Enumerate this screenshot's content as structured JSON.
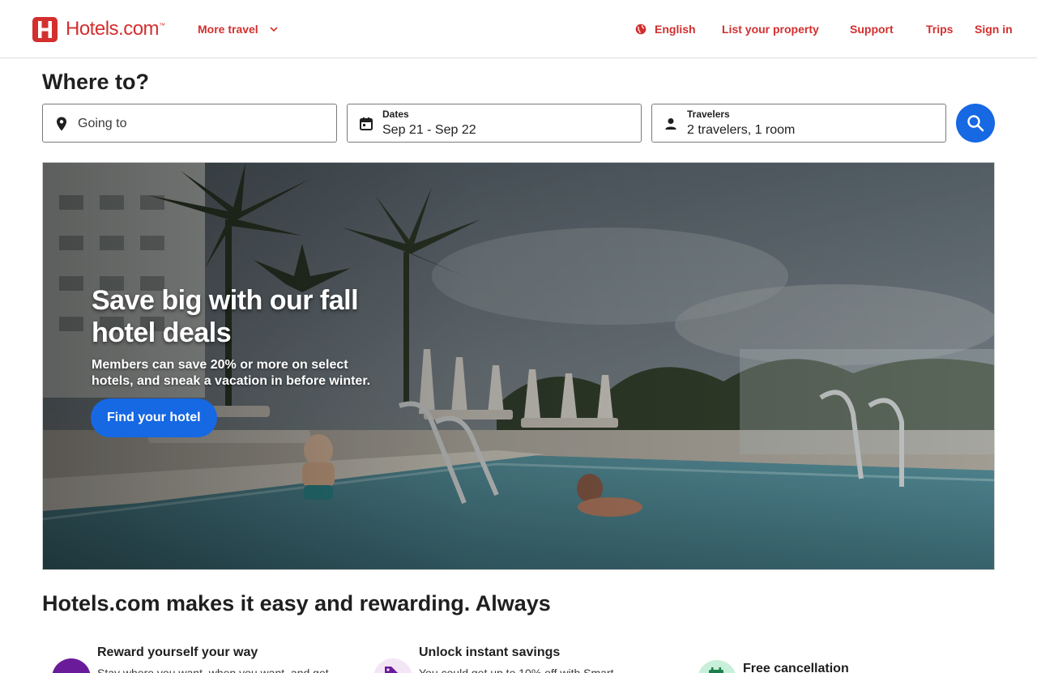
{
  "header": {
    "logo_text": "Hotels.com",
    "logo_tm": "™",
    "more_travel": "More travel",
    "language": "English",
    "list_property": "List your property",
    "support": "Support",
    "trips": "Trips",
    "sign_in": "Sign in",
    "brand_color": "#d32f2f"
  },
  "search": {
    "heading": "Where to?",
    "destination_placeholder": "Going to",
    "dates_label": "Dates",
    "dates_value": "Sep 21 - Sep 22",
    "travelers_label": "Travelers",
    "travelers_value": "2 travelers, 1 room",
    "button_color": "#1668e3"
  },
  "hero": {
    "title": "Save big with our fall hotel deals",
    "subtitle": "Members can save 20% or more on select hotels, and sneak a vacation in before winter.",
    "cta": "Find your hotel"
  },
  "section": {
    "title": "Hotels.com makes it easy and rewarding. Always",
    "features": [
      {
        "title": "Reward yourself your way",
        "desc": "Stay where you want, when you want, and get",
        "icon": "reward-icon",
        "color": "#6a1b9a"
      },
      {
        "title": "Unlock instant savings",
        "desc": "You could get up to 10% off with Smart",
        "icon": "tag-icon",
        "color": "#f3e5f5"
      },
      {
        "title": "Free cancellation",
        "desc": "",
        "icon": "calendar-icon",
        "color": "#c8efd9"
      }
    ]
  }
}
